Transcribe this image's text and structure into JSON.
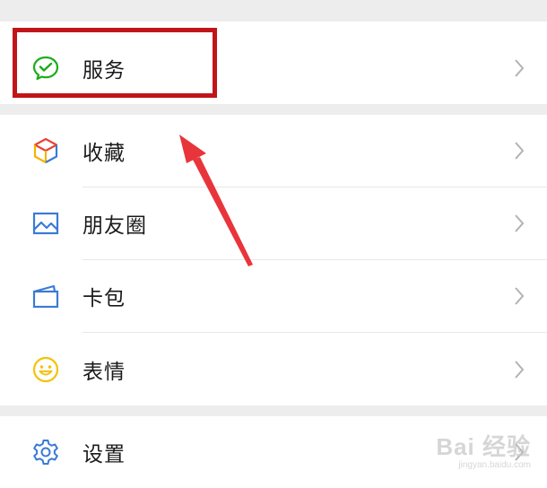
{
  "menu": {
    "items": [
      {
        "label": "服务",
        "icon": "wechat-pay-icon",
        "color": "#1aad19"
      },
      {
        "label": "收藏",
        "icon": "cube-favorites-icon",
        "color": "#f4b400"
      },
      {
        "label": "朋友圈",
        "icon": "moments-picture-icon",
        "color": "#3a7bd5"
      },
      {
        "label": "卡包",
        "icon": "card-wallet-icon",
        "color": "#3a7bd5"
      },
      {
        "label": "表情",
        "icon": "smiley-face-icon",
        "color": "#f4c20d"
      },
      {
        "label": "设置",
        "icon": "settings-gear-icon",
        "color": "#3a7bd5"
      }
    ]
  },
  "annotation": {
    "highlight_color": "#c0161a",
    "arrow_color": "#e8353b"
  },
  "watermark": {
    "main": "Bai 经验",
    "sub": "jingyan.baidu.com"
  }
}
